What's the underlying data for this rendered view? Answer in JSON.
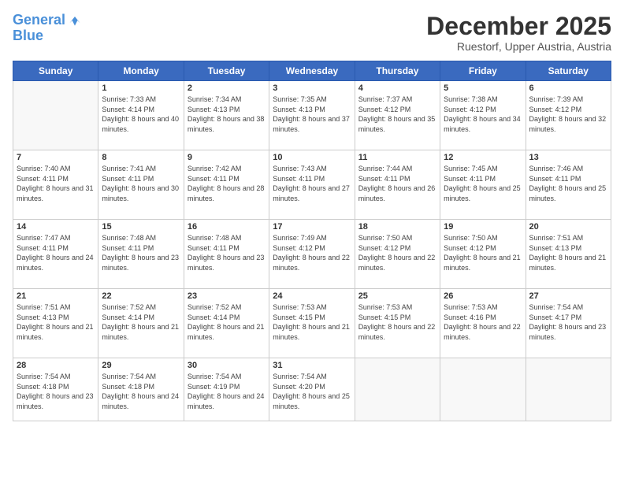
{
  "logo": {
    "line1": "General",
    "line2": "Blue"
  },
  "title": "December 2025",
  "subtitle": "Ruestorf, Upper Austria, Austria",
  "days_of_week": [
    "Sunday",
    "Monday",
    "Tuesday",
    "Wednesday",
    "Thursday",
    "Friday",
    "Saturday"
  ],
  "weeks": [
    [
      {
        "day": "",
        "sunrise": "",
        "sunset": "",
        "daylight": ""
      },
      {
        "day": "1",
        "sunrise": "Sunrise: 7:33 AM",
        "sunset": "Sunset: 4:14 PM",
        "daylight": "Daylight: 8 hours and 40 minutes."
      },
      {
        "day": "2",
        "sunrise": "Sunrise: 7:34 AM",
        "sunset": "Sunset: 4:13 PM",
        "daylight": "Daylight: 8 hours and 38 minutes."
      },
      {
        "day": "3",
        "sunrise": "Sunrise: 7:35 AM",
        "sunset": "Sunset: 4:13 PM",
        "daylight": "Daylight: 8 hours and 37 minutes."
      },
      {
        "day": "4",
        "sunrise": "Sunrise: 7:37 AM",
        "sunset": "Sunset: 4:12 PM",
        "daylight": "Daylight: 8 hours and 35 minutes."
      },
      {
        "day": "5",
        "sunrise": "Sunrise: 7:38 AM",
        "sunset": "Sunset: 4:12 PM",
        "daylight": "Daylight: 8 hours and 34 minutes."
      },
      {
        "day": "6",
        "sunrise": "Sunrise: 7:39 AM",
        "sunset": "Sunset: 4:12 PM",
        "daylight": "Daylight: 8 hours and 32 minutes."
      }
    ],
    [
      {
        "day": "7",
        "sunrise": "Sunrise: 7:40 AM",
        "sunset": "Sunset: 4:11 PM",
        "daylight": "Daylight: 8 hours and 31 minutes."
      },
      {
        "day": "8",
        "sunrise": "Sunrise: 7:41 AM",
        "sunset": "Sunset: 4:11 PM",
        "daylight": "Daylight: 8 hours and 30 minutes."
      },
      {
        "day": "9",
        "sunrise": "Sunrise: 7:42 AM",
        "sunset": "Sunset: 4:11 PM",
        "daylight": "Daylight: 8 hours and 28 minutes."
      },
      {
        "day": "10",
        "sunrise": "Sunrise: 7:43 AM",
        "sunset": "Sunset: 4:11 PM",
        "daylight": "Daylight: 8 hours and 27 minutes."
      },
      {
        "day": "11",
        "sunrise": "Sunrise: 7:44 AM",
        "sunset": "Sunset: 4:11 PM",
        "daylight": "Daylight: 8 hours and 26 minutes."
      },
      {
        "day": "12",
        "sunrise": "Sunrise: 7:45 AM",
        "sunset": "Sunset: 4:11 PM",
        "daylight": "Daylight: 8 hours and 25 minutes."
      },
      {
        "day": "13",
        "sunrise": "Sunrise: 7:46 AM",
        "sunset": "Sunset: 4:11 PM",
        "daylight": "Daylight: 8 hours and 25 minutes."
      }
    ],
    [
      {
        "day": "14",
        "sunrise": "Sunrise: 7:47 AM",
        "sunset": "Sunset: 4:11 PM",
        "daylight": "Daylight: 8 hours and 24 minutes."
      },
      {
        "day": "15",
        "sunrise": "Sunrise: 7:48 AM",
        "sunset": "Sunset: 4:11 PM",
        "daylight": "Daylight: 8 hours and 23 minutes."
      },
      {
        "day": "16",
        "sunrise": "Sunrise: 7:48 AM",
        "sunset": "Sunset: 4:11 PM",
        "daylight": "Daylight: 8 hours and 23 minutes."
      },
      {
        "day": "17",
        "sunrise": "Sunrise: 7:49 AM",
        "sunset": "Sunset: 4:12 PM",
        "daylight": "Daylight: 8 hours and 22 minutes."
      },
      {
        "day": "18",
        "sunrise": "Sunrise: 7:50 AM",
        "sunset": "Sunset: 4:12 PM",
        "daylight": "Daylight: 8 hours and 22 minutes."
      },
      {
        "day": "19",
        "sunrise": "Sunrise: 7:50 AM",
        "sunset": "Sunset: 4:12 PM",
        "daylight": "Daylight: 8 hours and 21 minutes."
      },
      {
        "day": "20",
        "sunrise": "Sunrise: 7:51 AM",
        "sunset": "Sunset: 4:13 PM",
        "daylight": "Daylight: 8 hours and 21 minutes."
      }
    ],
    [
      {
        "day": "21",
        "sunrise": "Sunrise: 7:51 AM",
        "sunset": "Sunset: 4:13 PM",
        "daylight": "Daylight: 8 hours and 21 minutes."
      },
      {
        "day": "22",
        "sunrise": "Sunrise: 7:52 AM",
        "sunset": "Sunset: 4:14 PM",
        "daylight": "Daylight: 8 hours and 21 minutes."
      },
      {
        "day": "23",
        "sunrise": "Sunrise: 7:52 AM",
        "sunset": "Sunset: 4:14 PM",
        "daylight": "Daylight: 8 hours and 21 minutes."
      },
      {
        "day": "24",
        "sunrise": "Sunrise: 7:53 AM",
        "sunset": "Sunset: 4:15 PM",
        "daylight": "Daylight: 8 hours and 21 minutes."
      },
      {
        "day": "25",
        "sunrise": "Sunrise: 7:53 AM",
        "sunset": "Sunset: 4:15 PM",
        "daylight": "Daylight: 8 hours and 22 minutes."
      },
      {
        "day": "26",
        "sunrise": "Sunrise: 7:53 AM",
        "sunset": "Sunset: 4:16 PM",
        "daylight": "Daylight: 8 hours and 22 minutes."
      },
      {
        "day": "27",
        "sunrise": "Sunrise: 7:54 AM",
        "sunset": "Sunset: 4:17 PM",
        "daylight": "Daylight: 8 hours and 23 minutes."
      }
    ],
    [
      {
        "day": "28",
        "sunrise": "Sunrise: 7:54 AM",
        "sunset": "Sunset: 4:18 PM",
        "daylight": "Daylight: 8 hours and 23 minutes."
      },
      {
        "day": "29",
        "sunrise": "Sunrise: 7:54 AM",
        "sunset": "Sunset: 4:18 PM",
        "daylight": "Daylight: 8 hours and 24 minutes."
      },
      {
        "day": "30",
        "sunrise": "Sunrise: 7:54 AM",
        "sunset": "Sunset: 4:19 PM",
        "daylight": "Daylight: 8 hours and 24 minutes."
      },
      {
        "day": "31",
        "sunrise": "Sunrise: 7:54 AM",
        "sunset": "Sunset: 4:20 PM",
        "daylight": "Daylight: 8 hours and 25 minutes."
      },
      {
        "day": "",
        "sunrise": "",
        "sunset": "",
        "daylight": ""
      },
      {
        "day": "",
        "sunrise": "",
        "sunset": "",
        "daylight": ""
      },
      {
        "day": "",
        "sunrise": "",
        "sunset": "",
        "daylight": ""
      }
    ]
  ]
}
